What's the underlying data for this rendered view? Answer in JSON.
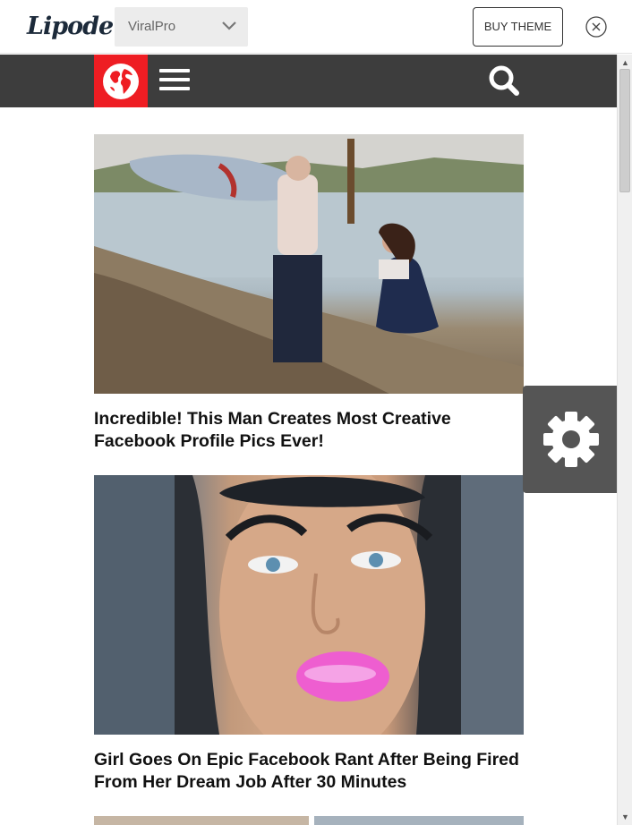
{
  "topbar": {
    "logo": "Lipode",
    "theme_select": {
      "value": "ViralPro"
    },
    "buy_button": "BUY THEME"
  },
  "site": {
    "accent_color": "#ee1d23",
    "navbar_color": "#3d3d3d",
    "icons": [
      "globe-icon",
      "hamburger-menu-icon",
      "search-icon",
      "gear-icon"
    ]
  },
  "posts": [
    {
      "title": "Incredible! This Man Creates Most Creative Facebook Profile Pics Ever!"
    },
    {
      "title": "Girl Goes On Epic Facebook Rant After Being Fired From Her Dream Job After 30 Minutes"
    }
  ]
}
